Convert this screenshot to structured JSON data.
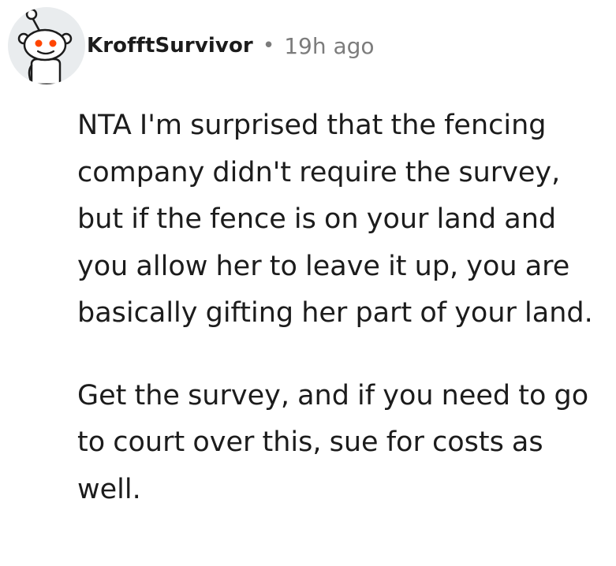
{
  "comment": {
    "author": "KrofftSurvivor",
    "separator": "•",
    "timestamp": "19h ago",
    "avatar_icon": "reddit-snoo-avatar-icon",
    "paragraphs": [
      "NTA I'm surprised that the fencing company didn't require the survey, but if the fence is on your land and you allow her to leave it up, you are basically gifting her part of your land.",
      "Get the survey, and if you need to go to court over this, sue for costs as well."
    ]
  },
  "colors": {
    "avatar_bg": "#e9ecee",
    "snoo_eye": "#ff4500",
    "text": "#1c1c1c",
    "meta_text": "#7c7c7c"
  }
}
